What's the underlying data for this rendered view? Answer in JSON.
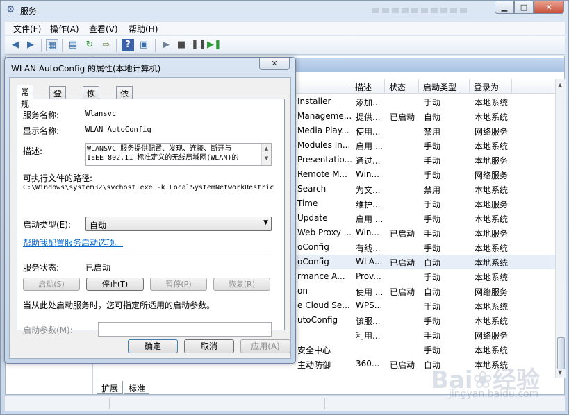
{
  "app": {
    "title": "服务",
    "icon": "gear-icon"
  },
  "caption": {
    "minimize": "▁",
    "maximize": "□",
    "close": "✕"
  },
  "menu": [
    "文件(F)",
    "操作(A)",
    "查看(V)",
    "帮助(H)"
  ],
  "toolbar": [
    "back-icon",
    "forward-icon",
    "console-tree-icon",
    "properties-icon",
    "refresh-icon",
    "export-icon",
    "help-icon",
    "view-icon",
    "play-icon",
    "stop-icon",
    "pause-icon",
    "restart-icon"
  ],
  "columns": {
    "desc": "描述",
    "status": "状态",
    "startup": "启动类型",
    "logon": "登录为"
  },
  "rows": [
    {
      "name": "Installer",
      "desc": "添加...",
      "status": "",
      "startup": "手动",
      "logon": "本地系统"
    },
    {
      "name": "Manageme...",
      "desc": "提供...",
      "status": "已启动",
      "startup": "自动",
      "logon": "本地系统"
    },
    {
      "name": "Media Play...",
      "desc": "使用...",
      "status": "",
      "startup": "禁用",
      "logon": "网络服务"
    },
    {
      "name": "Modules In...",
      "desc": "启用 ...",
      "status": "",
      "startup": "手动",
      "logon": "本地系统"
    },
    {
      "name": "Presentatio...",
      "desc": "通过...",
      "status": "",
      "startup": "手动",
      "logon": "本地服务"
    },
    {
      "name": "Remote M...",
      "desc": "Win...",
      "status": "",
      "startup": "手动",
      "logon": "网络服务"
    },
    {
      "name": "Search",
      "desc": "为文...",
      "status": "",
      "startup": "禁用",
      "logon": "本地系统"
    },
    {
      "name": "Time",
      "desc": "维护...",
      "status": "",
      "startup": "手动",
      "logon": "本地服务"
    },
    {
      "name": "Update",
      "desc": "启用 ...",
      "status": "",
      "startup": "手动",
      "logon": "本地系统"
    },
    {
      "name": "Web Proxy ...",
      "desc": "Win...",
      "status": "已启动",
      "startup": "手动",
      "logon": "本地服务"
    },
    {
      "name": "oConfig",
      "desc": "有线...",
      "status": "",
      "startup": "手动",
      "logon": "本地系统"
    },
    {
      "name": "oConfig",
      "desc": "WLA...",
      "status": "已启动",
      "startup": "自动",
      "logon": "本地系统"
    },
    {
      "name": "rmance A...",
      "desc": "Prov...",
      "status": "",
      "startup": "手动",
      "logon": "本地系统"
    },
    {
      "name": "on",
      "desc": "使用 ...",
      "status": "已启动",
      "startup": "自动",
      "logon": "网络服务"
    },
    {
      "name": "e Cloud Se...",
      "desc": "WPS...",
      "status": "",
      "startup": "手动",
      "logon": "本地系统"
    },
    {
      "name": "utoConfig",
      "desc": "该服...",
      "status": "",
      "startup": "手动",
      "logon": "本地系统"
    },
    {
      "name": "",
      "desc": "利用...",
      "status": "",
      "startup": "手动",
      "logon": "网络服务"
    },
    {
      "name": "安全中心",
      "desc": "",
      "status": "",
      "startup": "手动",
      "logon": "本地系统"
    },
    {
      "name": "主动防御",
      "desc": "360...",
      "status": "已启动",
      "startup": "自动",
      "logon": "本地系统"
    }
  ],
  "bottom_tabs": {
    "ext": "扩展",
    "std": "标准"
  },
  "watermark": {
    "brand": "Bai❀经验",
    "sub": "jingyan.baidu.com"
  },
  "dialog": {
    "title": "WLAN AutoConfig 的属性(本地计算机)",
    "close": "✕",
    "tabs": [
      "常规",
      "登录",
      "恢复",
      "依存关系"
    ],
    "service_name_label": "服务名称:",
    "service_name": "Wlansvc",
    "display_name_label": "显示名称:",
    "display_name": "WLAN AutoConfig",
    "desc_label": "描述:",
    "desc_line1": "WLANSVC 服务提供配置、发现、连接、断开与",
    "desc_line2": "IEEE 802.11 标准定义的无线局域网(WLAN)的",
    "path_label": "可执行文件的路径:",
    "path": "C:\\Windows\\system32\\svchost.exe -k LocalSystemNetworkRestric",
    "startup_label": "启动类型(E):",
    "startup_value": "自动",
    "help_link": "帮助我配置服务启动选项。",
    "status_label": "服务状态:",
    "status_value": "已启动",
    "buttons": {
      "start": "启动(S)",
      "stop": "停止(T)",
      "pause": "暂停(P)",
      "resume": "恢复(R)"
    },
    "hint": "当从此处启动服务时，您可指定所适用的启动参数。",
    "params_label": "启动参数(M):",
    "ok": "确定",
    "cancel": "取消",
    "apply": "应用(A)"
  }
}
